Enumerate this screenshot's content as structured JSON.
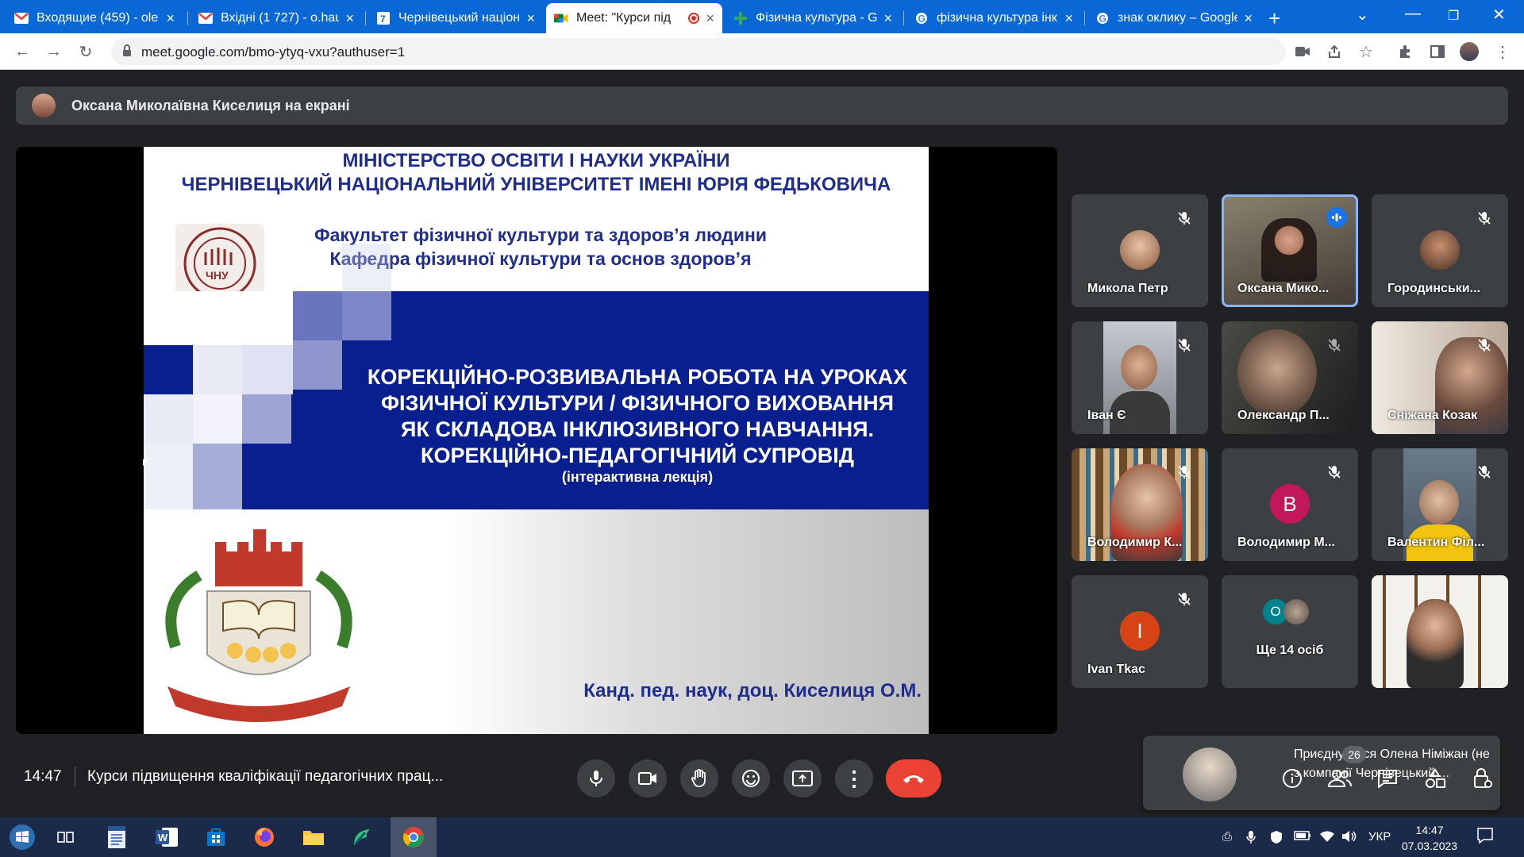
{
  "browser": {
    "tabs": [
      {
        "title": "Входящие (459) - ole",
        "icon": "gmail-icon"
      },
      {
        "title": "Вхідні (1 727) - o.hau",
        "icon": "gmail-icon"
      },
      {
        "title": "Чернівецький націон",
        "icon": "site-icon"
      },
      {
        "title": "Meet: \"Курси під",
        "icon": "meet-icon",
        "active": true
      },
      {
        "title": "Фізична культура - G",
        "icon": "classroom-icon"
      },
      {
        "title": "фізична культура інк",
        "icon": "google-icon"
      },
      {
        "title": "знак оклику – Google",
        "icon": "google-icon"
      }
    ],
    "url": "meet.google.com/bmo-ytyq-vxu?authuser=1"
  },
  "meet": {
    "presenter_text": "Оксана Миколаївна Киселиця на екрані",
    "slide": {
      "header_line1": "МІНІСТЕРСТВО ОСВІТИ І НАУКИ УКРАЇНИ",
      "header_line2": "ЧЕРНІВЕЦЬКИЙ НАЦІОНАЛЬНИЙ УНІВЕРСИТЕТ ІМЕНІ ЮРІЯ ФЕДЬКОВИЧА",
      "faculty_line1": "Факультет фізичної культури та здоров’я людини",
      "faculty_line2": "Кафедра фізичної культури та основ здоров’я",
      "title_line1": "КОРЕКЦІЙНО-РОЗВИВАЛЬНА  РОБОТА НА УРОКАХ",
      "title_line2": "ФІЗИЧНОЇ КУЛЬТУРИ / ФІЗИЧНОГО ВИХОВАННЯ",
      "title_line3": "ЯК СКЛАДОВА  ІНКЛЮЗИВНОГО  НАВЧАННЯ.",
      "title_line4": "КОРЕКЦІЙНО-ПЕДАГОГІЧНИЙ  СУПРОВІД",
      "subtitle": "(інтерактивна  лекція)",
      "author": "Канд. пед. наук, доц. Киселиця О.М.",
      "logo_text": "ЧНУ"
    },
    "participants": [
      {
        "name": "Микола Петр",
        "muted": true
      },
      {
        "name": "Оксана Мико...",
        "speaking": true
      },
      {
        "name": "Городинськи...",
        "muted": true
      },
      {
        "name": "Іван Є",
        "muted": true
      },
      {
        "name": "Олександр П...",
        "muted": true
      },
      {
        "name": "Сніжана Козак",
        "muted": true
      },
      {
        "name": "Володимир К...",
        "muted": true
      },
      {
        "name": "Володимир М...",
        "muted": true,
        "initial": "B",
        "color": "#c2185b"
      },
      {
        "name": "Валентин Філ...",
        "muted": true
      },
      {
        "name": "Ivan Tkac",
        "muted": true,
        "initial": "I",
        "color": "#d84315"
      },
      {
        "name": "Ще 14 осіб",
        "initial": "O",
        "color": "#00838f"
      },
      {
        "name": ""
      }
    ],
    "toast": "Приєднується Олена Німіжан (не з компанії Чернівецький ...",
    "time": "14:47",
    "meeting_title": "Курси підвищення кваліфікації педагогічних прац...",
    "participants_count": "26"
  },
  "taskbar": {
    "lang": "УКР",
    "time": "14:47",
    "date": "07.03.2023"
  },
  "colors": {
    "chrome_blue": "#0a67d6",
    "meet_bg": "#202124",
    "tile_bg": "#3c4043",
    "hangup": "#ea4335",
    "slide_navy": "#0a1f8f"
  }
}
